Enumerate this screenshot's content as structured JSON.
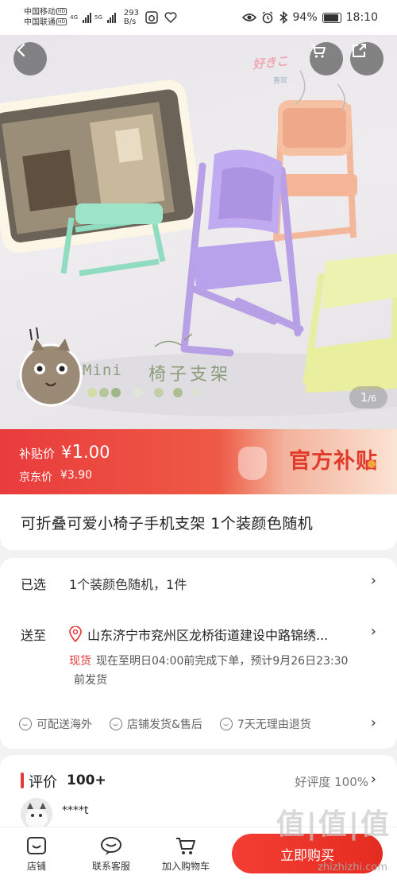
{
  "status_bar": {
    "carrier1": "中国移动",
    "carrier2": "中国联通",
    "carrier_tag": "HD",
    "net1": "4G",
    "net2": "5G",
    "speed_value": "293",
    "speed_unit": "B/s",
    "battery": "94%",
    "time": "18:10"
  },
  "hero": {
    "image_index": "1",
    "image_total": "/6",
    "mini_label": "Mini",
    "mini_cn": "椅子支架",
    "sticker_top": "好きこ",
    "sticker_sub": "喜欢"
  },
  "price": {
    "subsidy_label": "补贴价",
    "subsidy_currency": "¥",
    "subsidy_int": "1",
    "subsidy_dec": ".00",
    "jd_label": "京东价",
    "jd_price": "¥3.90",
    "badge": "官方补贴"
  },
  "product": {
    "title": "可折叠可爱小椅子手机支架 1个装颜色随机"
  },
  "spec": {
    "selected_label": "已选",
    "selected_value": "1个装颜色随机，1件",
    "ship_label": "送至",
    "address": "山东济宁市兖州区龙桥街道建设中路锦绣...",
    "stock": "现货",
    "eta_line1": "现在至明日04:00前完成下单，预计9月26日23:30",
    "eta_line2": "前发货",
    "services": [
      "可配送海外",
      "店铺发货&售后",
      "7天无理由退货"
    ]
  },
  "review": {
    "title": "评价",
    "count": "100+",
    "rating": "好评度 100%",
    "user": "****t"
  },
  "bottom_bar": {
    "shop": "店铺",
    "service": "联系客服",
    "cart": "加入购物车",
    "buy": "立即购买"
  },
  "watermark": {
    "logo": "值|值|值",
    "site": "zhizhizhi.com"
  },
  "colors": {
    "accent": "#e4393c",
    "price_banner": "#ea3e3e"
  }
}
